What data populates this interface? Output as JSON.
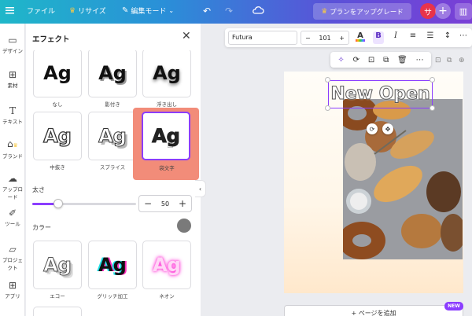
{
  "topbar": {
    "file": "ファイル",
    "resize": "リサイズ",
    "edit_mode": "編集モード",
    "upgrade": "プランをアップグレード",
    "avatar_initial": "サ",
    "colors": {
      "brand_start": "#1fb7c9",
      "brand_end": "#7a3fd6",
      "avatar": "#e8334a",
      "crown": "#f7c948"
    }
  },
  "rail": {
    "items": [
      {
        "label": "デザイン",
        "icon": "layout-icon"
      },
      {
        "label": "素材",
        "icon": "elements-icon"
      },
      {
        "label": "テキスト",
        "icon": "text-icon"
      },
      {
        "label": "ブランド",
        "icon": "brand-icon"
      },
      {
        "label": "アップロード",
        "icon": "upload-icon"
      },
      {
        "label": "ツール",
        "icon": "draw-icon"
      },
      {
        "label": "プロジェクト",
        "icon": "folder-icon"
      },
      {
        "label": "アプリ",
        "icon": "apps-icon"
      }
    ]
  },
  "effects_panel": {
    "title": "エフェクト",
    "sample_text": "Ag",
    "effects": [
      {
        "label": "なし"
      },
      {
        "label": "影付き"
      },
      {
        "label": "浮き出し"
      },
      {
        "label": "中抜き"
      },
      {
        "label": "スプライス"
      },
      {
        "label": "袋文字"
      },
      {
        "label": "エコー"
      },
      {
        "label": "グリッチ加工"
      },
      {
        "label": "ネオン"
      }
    ],
    "selected_effect": "袋文字",
    "thickness_label": "太さ",
    "thickness_value": "50",
    "thickness_fraction": 0.5,
    "color_label": "カラー",
    "color_value": "#7a7a7a",
    "accent": "#8b3dff",
    "highlight_color": "#f28c79"
  },
  "text_toolbar": {
    "font": "Futura",
    "size": "101",
    "minus": "−",
    "plus": "+"
  },
  "canvas": {
    "text": "New Open",
    "add_page": "+ ページを追加",
    "new_badge": "NEW"
  }
}
